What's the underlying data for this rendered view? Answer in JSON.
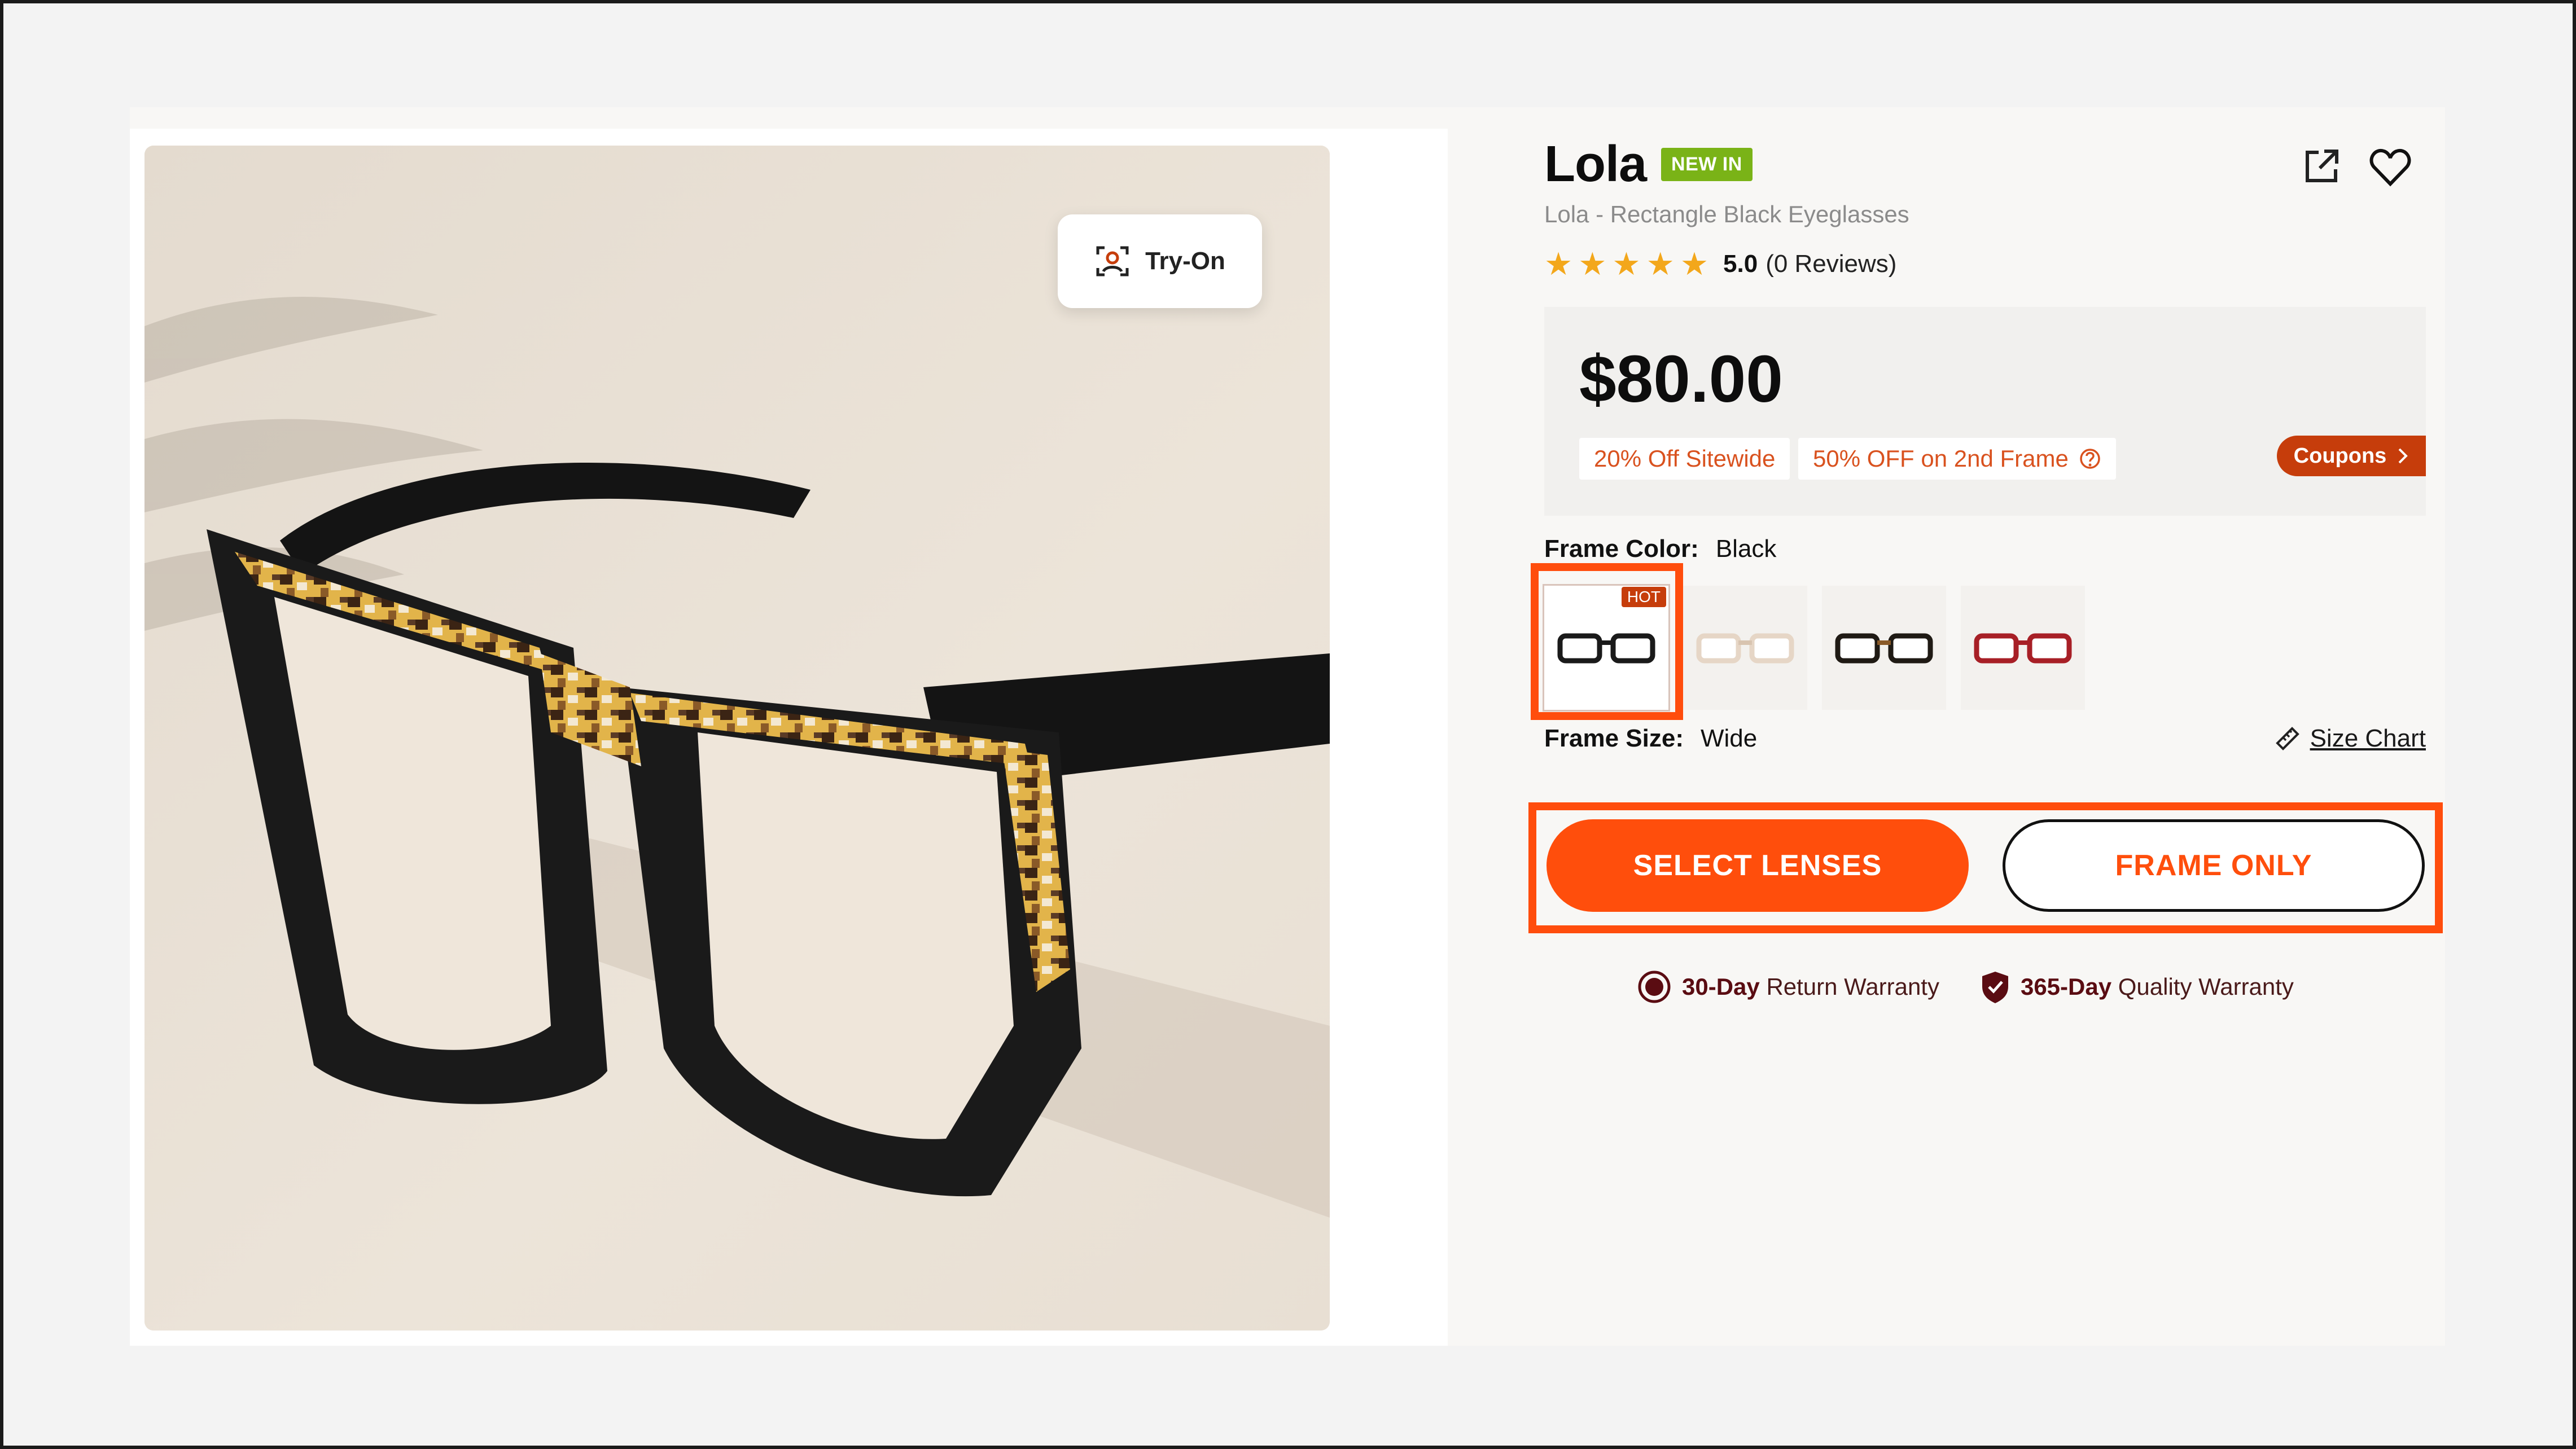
{
  "gallery": {
    "try_on_label": "Try-On"
  },
  "product": {
    "name": "Lola",
    "badge": "NEW IN",
    "subtitle": "Lola - Rectangle Black Eyeglasses",
    "rating_value": "5.0",
    "reviews_text": "(0 Reviews)",
    "stars": 5
  },
  "pricing": {
    "price": "$80.00",
    "promos": [
      "20% Off Sitewide",
      "50% OFF on 2nd Frame"
    ],
    "coupons_label": "Coupons"
  },
  "frame_color": {
    "label": "Frame Color:",
    "value": "Black",
    "hot_badge": "HOT",
    "swatches": [
      {
        "name": "black",
        "frame_color": "#1a1a1a",
        "lens_color": "#ffffff"
      },
      {
        "name": "clear",
        "frame_color": "#e6d6c6",
        "lens_color": "#ffffff"
      },
      {
        "name": "black-tortoise",
        "frame_color": "#1f1a14",
        "lens_color": "#ffffff"
      },
      {
        "name": "red",
        "frame_color": "#a71f26",
        "lens_color": "#ffffff"
      }
    ]
  },
  "frame_size": {
    "label": "Frame Size:",
    "value": "Wide",
    "size_chart_label": "Size Chart"
  },
  "actions": {
    "select_lenses": "SELECT LENSES",
    "frame_only": "FRAME ONLY"
  },
  "warranties": [
    {
      "bold": "30-Day",
      "text": "Return Warranty"
    },
    {
      "bold": "365-Day",
      "text": "Quality Warranty"
    }
  ],
  "colors": {
    "accent": "#ff4e0c",
    "highlight": "#ff4d0d",
    "new_badge": "#7ab317",
    "coupon": "#c63d0b",
    "star": "#f3a71b"
  }
}
